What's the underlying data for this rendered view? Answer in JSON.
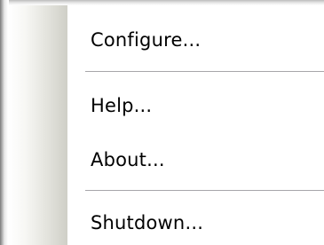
{
  "context_menu": {
    "items": [
      {
        "label": "Configure..."
      },
      {
        "label": "Help..."
      },
      {
        "label": "About..."
      },
      {
        "label": "Shutdown..."
      }
    ]
  },
  "colors": {
    "menu_background": "#ffffff",
    "icon_strip_dark": "#cfcfc7",
    "separator": "#a7a6aa",
    "text": "#000000"
  }
}
